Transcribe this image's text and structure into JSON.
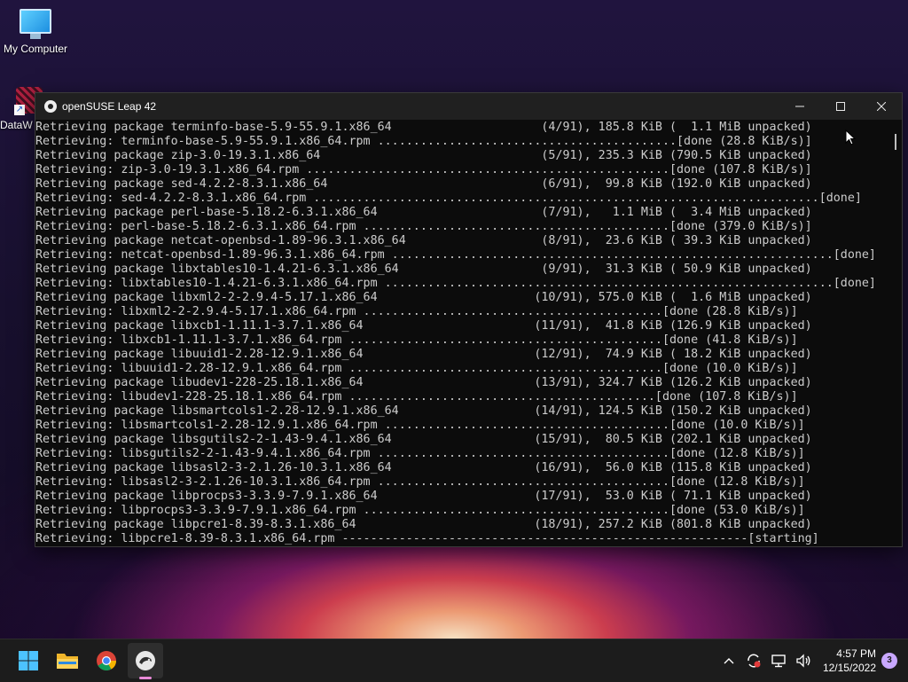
{
  "desktop": {
    "icons": [
      {
        "label": "My Computer"
      },
      {
        "label": "DataW"
      }
    ]
  },
  "window": {
    "title": "openSUSE Leap 42",
    "controls": {
      "minimize": "minimize-icon",
      "maximize": "maximize-icon",
      "close": "close-icon"
    }
  },
  "terminal": {
    "lines": [
      "Retrieving package terminfo-base-5.9-55.9.1.x86_64                     (4/91), 185.8 KiB (  1.1 MiB unpacked)",
      "Retrieving: terminfo-base-5.9-55.9.1.x86_64.rpm ..........................................[done (28.8 KiB/s)]",
      "Retrieving package zip-3.0-19.3.1.x86_64                               (5/91), 235.3 KiB (790.5 KiB unpacked)",
      "Retrieving: zip-3.0-19.3.1.x86_64.rpm ...................................................[done (107.8 KiB/s)]",
      "Retrieving package sed-4.2.2-8.3.1.x86_64                              (6/91),  99.8 KiB (192.0 KiB unpacked)",
      "Retrieving: sed-4.2.2-8.3.1.x86_64.rpm .......................................................................[done]",
      "Retrieving package perl-base-5.18.2-6.3.1.x86_64                       (7/91),   1.1 MiB (  3.4 MiB unpacked)",
      "Retrieving: perl-base-5.18.2-6.3.1.x86_64.rpm ...........................................[done (379.0 KiB/s)]",
      "Retrieving package netcat-openbsd-1.89-96.3.1.x86_64                   (8/91),  23.6 KiB ( 39.3 KiB unpacked)",
      "Retrieving: netcat-openbsd-1.89-96.3.1.x86_64.rpm ..............................................................[done]",
      "Retrieving package libxtables10-1.4.21-6.3.1.x86_64                    (9/91),  31.3 KiB ( 50.9 KiB unpacked)",
      "Retrieving: libxtables10-1.4.21-6.3.1.x86_64.rpm ...............................................................[done]",
      "Retrieving package libxml2-2-2.9.4-5.17.1.x86_64                      (10/91), 575.0 KiB (  1.6 MiB unpacked)",
      "Retrieving: libxml2-2-2.9.4-5.17.1.x86_64.rpm ..........................................[done (28.8 KiB/s)]",
      "Retrieving package libxcb1-1.11.1-3.7.1.x86_64                        (11/91),  41.8 KiB (126.9 KiB unpacked)",
      "Retrieving: libxcb1-1.11.1-3.7.1.x86_64.rpm ............................................[done (41.8 KiB/s)]",
      "Retrieving package libuuid1-2.28-12.9.1.x86_64                        (12/91),  74.9 KiB ( 18.2 KiB unpacked)",
      "Retrieving: libuuid1-2.28-12.9.1.x86_64.rpm ............................................[done (10.0 KiB/s)]",
      "Retrieving package libudev1-228-25.18.1.x86_64                        (13/91), 324.7 KiB (126.2 KiB unpacked)",
      "Retrieving: libudev1-228-25.18.1.x86_64.rpm ...........................................[done (107.8 KiB/s)]",
      "Retrieving package libsmartcols1-2.28-12.9.1.x86_64                   (14/91), 124.5 KiB (150.2 KiB unpacked)",
      "Retrieving: libsmartcols1-2.28-12.9.1.x86_64.rpm ........................................[done (10.0 KiB/s)]",
      "Retrieving package libsgutils2-2-1.43-9.4.1.x86_64                    (15/91),  80.5 KiB (202.1 KiB unpacked)",
      "Retrieving: libsgutils2-2-1.43-9.4.1.x86_64.rpm .........................................[done (12.8 KiB/s)]",
      "Retrieving package libsasl2-3-2.1.26-10.3.1.x86_64                    (16/91),  56.0 KiB (115.8 KiB unpacked)",
      "Retrieving: libsasl2-3-2.1.26-10.3.1.x86_64.rpm .........................................[done (12.8 KiB/s)]",
      "Retrieving package libprocps3-3.3.9-7.9.1.x86_64                      (17/91),  53.0 KiB ( 71.1 KiB unpacked)",
      "Retrieving: libprocps3-3.3.9-7.9.1.x86_64.rpm ...........................................[done (53.0 KiB/s)]",
      "Retrieving package libpcre1-8.39-8.3.1.x86_64                         (18/91), 257.2 KiB (801.8 KiB unpacked)",
      "Retrieving: libpcre1-8.39-8.3.1.x86_64.rpm ---------------------------------------------------------[starting]"
    ]
  },
  "taskbar": {
    "apps": [
      {
        "name": "start",
        "icon": "windows-logo-icon"
      },
      {
        "name": "file-explorer",
        "icon": "folder-icon"
      },
      {
        "name": "chrome",
        "icon": "chrome-icon"
      },
      {
        "name": "opensuse",
        "icon": "opensuse-icon",
        "active": true
      }
    ],
    "tray": {
      "time": "4:57 PM",
      "date": "12/15/2022",
      "notifications": "3"
    }
  }
}
